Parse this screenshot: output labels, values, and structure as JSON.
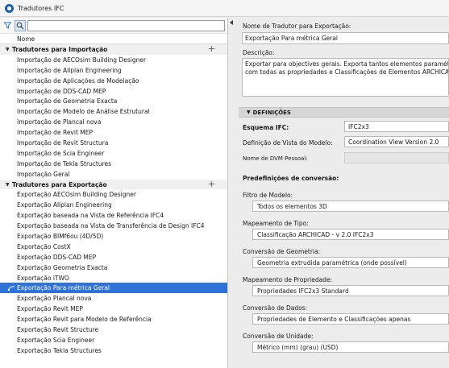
{
  "window": {
    "title": "Tradutores IFC"
  },
  "left": {
    "search": {
      "value": "",
      "placeholder": ""
    },
    "column_header": "Nome",
    "import_group": {
      "label": "Tradutores para Importação",
      "items": [
        "Importação de AECOsim Building Designer",
        "Importação de Allplan Engineering",
        "Importação de Aplicações de Modelação",
        "Importação de DDS-CAD MEP",
        "Importação de Geometria Exacta",
        "Importação de Modelo de Análise Estrutural",
        "Importação de Plancal nova",
        "Importação de Revit MEP",
        "Importação de Revit Structura",
        "Importação de Scia Engineer",
        "Importação de Tekla Structures",
        "Importação Geral"
      ]
    },
    "export_group": {
      "label": "Tradutores para Exportação",
      "items": [
        "Exportação AECOsim Building Designer",
        "Exportação Allplan Engineering",
        "Exportação baseada na Vista de Referência IFC4",
        "Exportação baseada na Vista de Transferência de Design IFC4",
        "Exportação BIMf6ou (4D/5D)",
        "Exportação CostX",
        "Exportação DDS-CAD MEP",
        "Exportação Geometria Exacta",
        "Exportação iTWO",
        "Exportação Para métrica Geral",
        "Exportação Plancal nova",
        "Exportação Revit MEP",
        "Exportação Revit para Modelo de Referência",
        "Exportação Revit Structure",
        "Exportação Scia Engineer",
        "Exportação Tekla Structures"
      ],
      "selected_index": 9
    }
  },
  "right": {
    "name_label": "Nome de Tradutor para Exportação:",
    "name_value": "Exportação Para métrica Geral",
    "desc_label": "Descrição:",
    "desc_line1": "Exportar para objectives gerais. Exporta tantos elementos paramétricos quant",
    "desc_line2": "com todas as propriedades e Classificações de Elementos ARCHICAD.",
    "section_label": "DEFINIÇÕES",
    "schema_label": "Esquema IFC:",
    "schema_value": "IFC2x3",
    "mvd_label": "Definição de Vista do Modelo:",
    "mvd_value": "Coordination View Version 2.0",
    "dvm_label": "Nome de DVM Pessoal:",
    "dvm_value": "",
    "presets_label": "Predefinições de conversão:",
    "model_filter_label": "Filtro de Modelo:",
    "model_filter_value": "Todos os elementos 3D",
    "type_map_label": "Mapeamento de Tipo:",
    "type_map_value": "Classificação ARCHICAD - v 2.0 IFC2x3",
    "geometry_label": "Conversão de Geometria:",
    "geometry_value": "Geometria extrudida paramétrica (onde possível)",
    "property_map_label": "Mapeamento de Propriedade:",
    "property_map_value": "Propriedades IFC2x3 Standard",
    "data_conv_label": "Conversão de Dados:",
    "data_conv_value": "Propriedades de Elemento e Classificações apenas",
    "unit_conv_label": "Conversão de Unidade:",
    "unit_conv_value": "Métrico (mm) (grau) (USD)"
  }
}
